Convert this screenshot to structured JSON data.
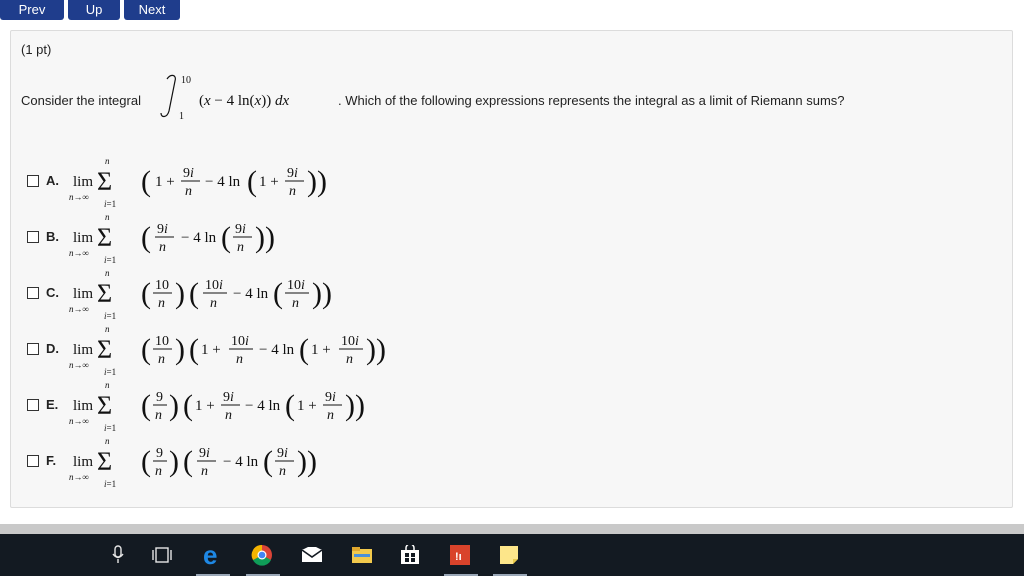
{
  "nav": {
    "prev_label": "Prev",
    "up_label": "Up",
    "next_label": "Next"
  },
  "problem": {
    "points": "(1 pt)",
    "question_lead": "Consider the integral",
    "question_tail": ". Which of the following expressions represents the integral as a limit of Riemann sums?",
    "integral": {
      "upper": "10",
      "lower": "1",
      "integrand": "(x − 4 ln(x)) dx"
    }
  },
  "options": [
    {
      "label": "A.",
      "expression": "lim n→∞ Σ_{i=1}^{n} (1 + 9i/n − 4 ln(1 + 9i/n))"
    },
    {
      "label": "B.",
      "expression": "lim n→∞ Σ_{i=1}^{n} (9i/n − 4 ln(9i/n))"
    },
    {
      "label": "C.",
      "expression": "lim n→∞ Σ_{i=1}^{n} (10/n)(10i/n − 4 ln(10i/n))"
    },
    {
      "label": "D.",
      "expression": "lim n→∞ Σ_{i=1}^{n} (10/n)(1 + 10i/n − 4 ln(1 + 10i/n))"
    },
    {
      "label": "E.",
      "expression": "lim n→∞ Σ_{i=1}^{n} (9/n)(1 + 9i/n − 4 ln(1 + 9i/n))"
    },
    {
      "label": "F.",
      "expression": "lim n→∞ Σ_{i=1}^{n} (9/n)(9i/n − 4 ln(9i/n))"
    }
  ],
  "taskbar": {
    "icons": [
      "microphone-icon",
      "task-view-icon",
      "edge-icon",
      "chrome-icon",
      "mail-icon",
      "file-explorer-icon",
      "store-icon",
      "office-icon",
      "sticky-notes-icon"
    ]
  }
}
